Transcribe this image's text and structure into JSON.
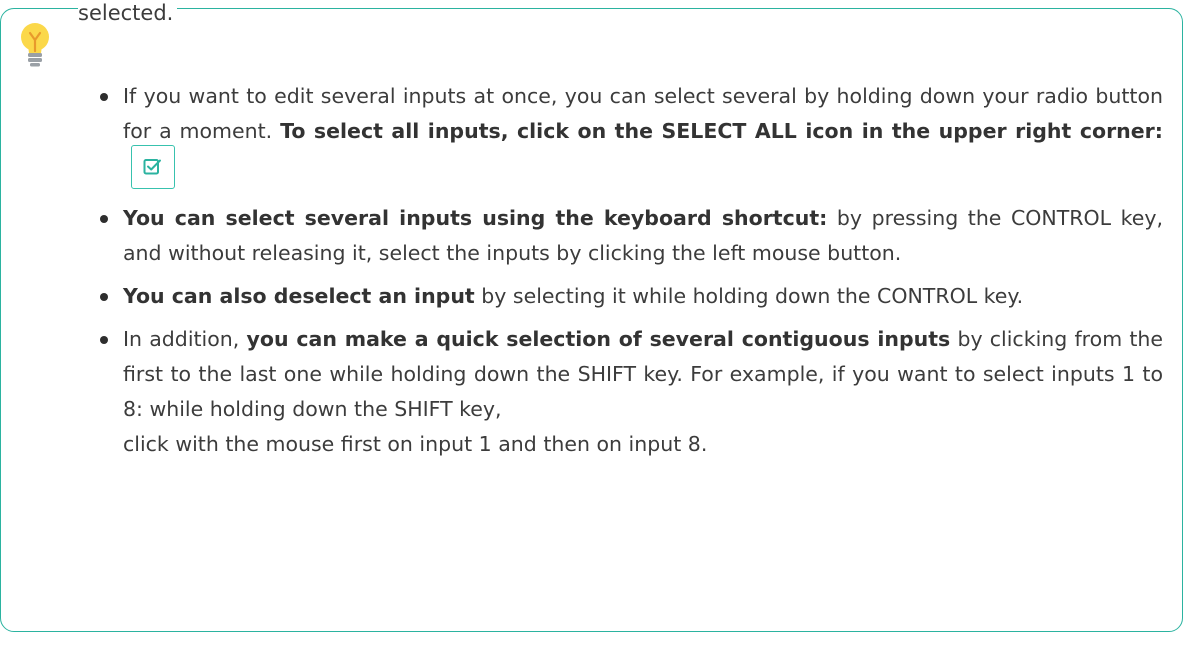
{
  "callout": {
    "accent_color": "#2bb3a0",
    "icon": "lightbulb-icon",
    "fragment_text": "selected."
  },
  "tips": [
    {
      "t1": "If you want to edit several inputs at once, you can select several by holding down your radio button for a moment. ",
      "b1": "To select all inputs, click on the SELECT ALL icon in the upper right corner:",
      "icon": "select-all-checkbox-icon"
    },
    {
      "b1": "You can select several inputs using the keyboard shortcut:",
      "t1": " by pressing the CONTROL key, and without releasing it, select the inputs by clicking the left mouse button."
    },
    {
      "b1": "You can also deselect an input",
      "t1": " by selecting it while holding down the CONTROL key."
    },
    {
      "t1": "In addition, ",
      "b1": "you can make a quick selection of several contiguous inputs",
      "t2": " by clicking from the first to the last one while holding down the SHIFT key. For example, if you want to select inputs 1 to 8: while holding down the SHIFT key,",
      "t3": "click with the mouse first on input 1 and then on input 8."
    }
  ]
}
